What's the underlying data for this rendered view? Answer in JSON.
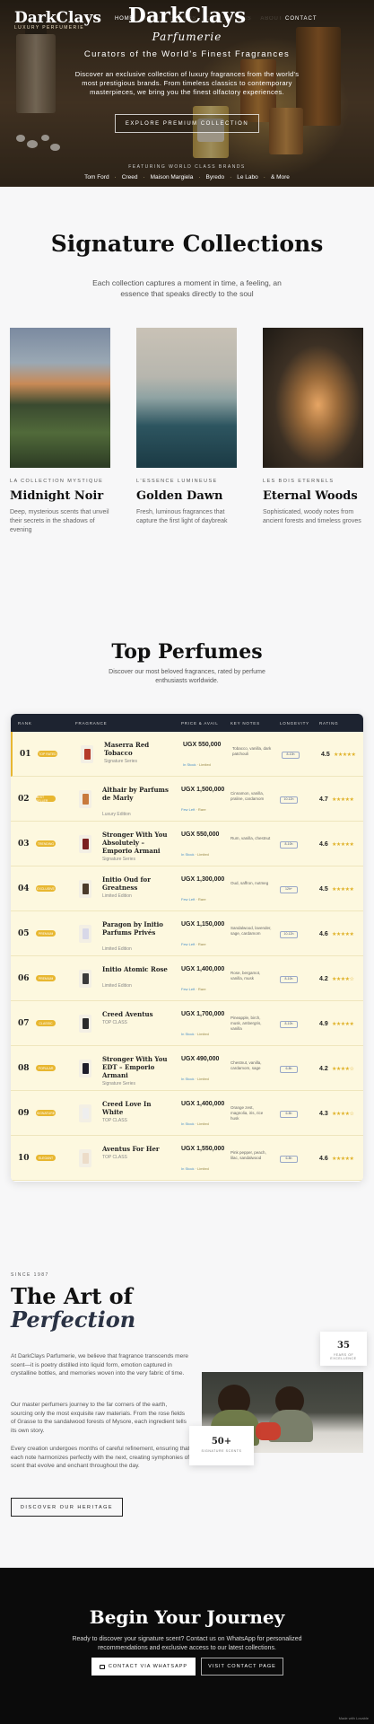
{
  "nav": {
    "logo": "DarkClays",
    "logo_sub": "LUXURY PERFUMERIE",
    "links": [
      "HOME",
      "SHOP",
      "BRANDS",
      "COLLECTIONS",
      "ABOUT"
    ],
    "contact": "CONTACT"
  },
  "hero": {
    "title": "DarkClays",
    "subtitle": "Parfumerie",
    "tagline": "Curators of the World's Finest Fragrances",
    "description": "Discover an exclusive collection of luxury fragrances from the world's most prestigious brands. From timeless classics to contemporary masterpieces, we bring you the finest olfactory experiences.",
    "button": "EXPLORE PREMIUM COLLECTION",
    "featured_label": "FEATURING WORLD CLASS BRANDS",
    "brands": [
      "Tom Ford",
      "Creed",
      "Maison Margiela",
      "Byredo",
      "Le Labo",
      "& More"
    ]
  },
  "collections": {
    "title": "Signature Collections",
    "description": "Each collection captures a moment in time, a feeling, an essence that speaks directly to the soul",
    "cards": [
      {
        "eyebrow": "LA COLLECTION MYSTIQUE",
        "name": "Midnight Noir",
        "desc": "Deep, mysterious scents that unveil their secrets in the shadows of evening"
      },
      {
        "eyebrow": "L'ESSENCE LUMINEUSE",
        "name": "Golden Dawn",
        "desc": "Fresh, luminous fragrances that capture the first light of daybreak"
      },
      {
        "eyebrow": "LES BOIS ETERNELS",
        "name": "Eternal Woods",
        "desc": "Sophisticated, woody notes from ancient forests and timeless groves"
      }
    ]
  },
  "top_perfumes": {
    "title": "Top Perfumes",
    "description": "Discover our most beloved fragrances, rated by perfume enthusiasts worldwide.",
    "columns": [
      "RANK",
      "FRAGRANCE",
      "PRICE & AVAIL",
      "KEY NOTES",
      "LONGEVITY",
      "RATING"
    ],
    "rows": [
      {
        "rank": "01",
        "badge": "TOP RATED",
        "name": "Maserra Red Tobacco",
        "brand": "Signature Series",
        "price": "UGX 550,000",
        "avail": "In Stock",
        "note_avail": "Limited",
        "notes": "Tobacco, vanilla, dark patchouli",
        "longevity": "8-10h",
        "rating": "4.5",
        "stars": "★★★★★",
        "color": "#b43a2a"
      },
      {
        "rank": "02",
        "badge": "BEST SELLER",
        "name": "Althair by Parfums de Marly",
        "brand": "Luxury Edition",
        "price": "UGX 1,500,000",
        "avail": "Few Left",
        "note_avail": "Rare",
        "notes": "Cinnamon, vanilla, praline, cardamom",
        "longevity": "10-12h",
        "rating": "4.7",
        "stars": "★★★★★",
        "color": "#c87a3c"
      },
      {
        "rank": "03",
        "badge": "TRENDING",
        "name": "Stronger With You Absolutely – Emporio Armani",
        "brand": "Signature Series",
        "price": "UGX 550,000",
        "avail": "In Stock",
        "note_avail": "Limited",
        "notes": "Rum, vanilla, chestnut",
        "longevity": "8-10h",
        "rating": "4.6",
        "stars": "★★★★★",
        "color": "#7a1f1f"
      },
      {
        "rank": "04",
        "badge": "EXCLUSIVE",
        "name": "Initio Oud for Greatness",
        "brand": "Limited Edition",
        "price": "UGX 1,300,000",
        "avail": "Few Left",
        "note_avail": "Rare",
        "notes": "Oud, saffron, nutmeg",
        "longevity": "12h+",
        "rating": "4.5",
        "stars": "★★★★★",
        "color": "#4a3a2a"
      },
      {
        "rank": "05",
        "badge": "PREMIUM",
        "name": "Paragon by Initio Parfums Privés",
        "brand": "Limited Edition",
        "price": "UGX 1,150,000",
        "avail": "Few Left",
        "note_avail": "Rare",
        "notes": "Sandalwood, lavender, sage, cardamom",
        "longevity": "10-12h",
        "rating": "4.6",
        "stars": "★★★★★",
        "color": "#d8d8e8"
      },
      {
        "rank": "06",
        "badge": "PREMIUM",
        "name": "Initio Atomic Rose",
        "brand": "Limited Edition",
        "price": "UGX 1,400,000",
        "avail": "Few Left",
        "note_avail": "Rare",
        "notes": "Rose, bergamot, vanilla, musk",
        "longevity": "8-10h",
        "rating": "4.2",
        "stars": "★★★★☆",
        "color": "#3a3a3a"
      },
      {
        "rank": "07",
        "badge": "CLASSIC",
        "name": "Creed Aventus",
        "brand": "TOP CLASS",
        "price": "UGX 1,700,000",
        "avail": "In Stock",
        "note_avail": "Limited",
        "notes": "Pineapple, birch, musk, ambergris, vanilla",
        "longevity": "8-10h",
        "rating": "4.9",
        "stars": "★★★★★",
        "color": "#2a2a2a"
      },
      {
        "rank": "08",
        "badge": "POPULAR",
        "name": "Stronger With You EDT – Emporio Armani",
        "brand": "Signature Series",
        "price": "UGX 490,000",
        "avail": "In Stock",
        "note_avail": "Limited",
        "notes": "Chestnut, vanilla, cardamom, sage",
        "longevity": "6-8h",
        "rating": "4.2",
        "stars": "★★★★☆",
        "color": "#1d1d2a"
      },
      {
        "rank": "09",
        "badge": "SIGNATURE",
        "name": "Creed Love In White",
        "brand": "TOP CLASS",
        "price": "UGX 1,400,000",
        "avail": "In Stock",
        "note_avail": "Limited",
        "notes": "Orange zest, magnolia, iris, rice husk",
        "longevity": "6-8h",
        "rating": "4.3",
        "stars": "★★★★☆",
        "color": "#eeeeee"
      },
      {
        "rank": "10",
        "badge": "ELEGANT",
        "name": "Aventus For Her",
        "brand": "TOP CLASS",
        "price": "UGX 1,550,000",
        "avail": "In Stock",
        "note_avail": "Limited",
        "notes": "Pink pepper, peach, lilac, sandalwood",
        "longevity": "6-8h",
        "rating": "4.6",
        "stars": "★★★★★",
        "color": "#ecdcc8"
      }
    ]
  },
  "art": {
    "since": "SINCE 1987",
    "title1": "The Art of",
    "title2": "Perfection",
    "para1": "At DarkClays Parfumerie, we believe that fragrance transcends mere scent—it is poetry distilled into liquid form, emotion captured in crystalline bottles, and memories woven into the very fabric of time.",
    "para2": "Our master perfumers journey to the far corners of the earth, sourcing only the most exquisite raw materials. From the rose fields of Grasse to the sandalwood forests of Mysore, each ingredient tells its own story.",
    "para3": "Every creation undergoes months of careful refinement, ensuring that each note harmonizes perfectly with the next, creating symphonies of scent that evolve and enchant throughout the day.",
    "button": "DISCOVER OUR HERITAGE",
    "stat1_num": "35",
    "stat1_label": "YEARS OF EXCELLENCE",
    "stat2_num": "50+",
    "stat2_label": "SIGNATURE SCENTS"
  },
  "cta": {
    "title": "Begin Your Journey",
    "description": "Ready to discover your signature scent? Contact us on WhatsApp for personalized recommendations and exclusive access to our latest collections.",
    "button1": "CONTACT VIA WHATSAPP",
    "button2": "VISIT CONTACT PAGE",
    "made": "Made with Lovable"
  }
}
